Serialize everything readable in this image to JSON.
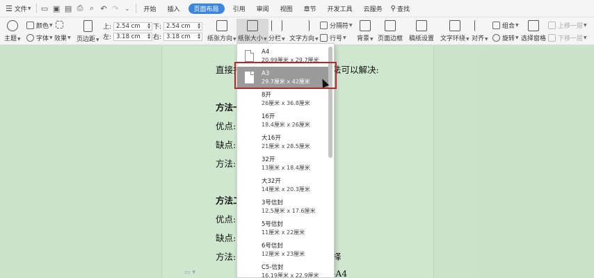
{
  "menubar": {
    "file_label": "文件",
    "tabs": [
      {
        "label": "开始"
      },
      {
        "label": "插入"
      },
      {
        "label": "页面布局"
      },
      {
        "label": "引用"
      },
      {
        "label": "审阅"
      },
      {
        "label": "视图"
      },
      {
        "label": "章节"
      },
      {
        "label": "开发工具"
      },
      {
        "label": "云服务"
      }
    ],
    "search_label": "查找"
  },
  "ribbon": {
    "theme_label": "主题",
    "color_label": "颜色",
    "font_label": "字体",
    "effect_label": "效果",
    "margin_label": "页边距",
    "top_label": "上:",
    "top_value": "2.54 cm",
    "bottom_label": "下:",
    "bottom_value": "2.54 cm",
    "left_label": "左:",
    "left_value": "3.18 cm",
    "right_label": "右:",
    "right_value": "3.18 cm",
    "orientation_label": "纸张方向",
    "paper_size_label": "纸张大小",
    "columns_label": "分栏",
    "text_direction_label": "文字方向",
    "separator_label": "分隔符",
    "line_number_label": "行号",
    "background_label": "背景",
    "page_border_label": "页面边框",
    "draft_setting_label": "稿纸设置",
    "text_wrap_label": "文字环绕",
    "align_label": "对齐",
    "group_label": "组合",
    "rotate_label": "旋转",
    "selection_pane_label": "选择窗格",
    "bring_forward_label": "上移一层",
    "send_backward_label": "下移一层"
  },
  "document": {
    "lines": [
      {
        "text": "直接打",
        "bold": false
      },
      {
        "text": "法可以解决:",
        "bold": false
      },
      {
        "text": "方法一",
        "bold": true
      },
      {
        "text": "优点:",
        "bold": false
      },
      {
        "text": "缺点:",
        "bold": false
      },
      {
        "text": "方法:",
        "bold": false
      },
      {
        "text": "方法二",
        "bold": true
      },
      {
        "text": "优点:",
        "bold": false
      },
      {
        "text": "缺点:",
        "bold": false
      },
      {
        "text": "方法:",
        "bold": false
      },
      {
        "text": "择",
        "bold": false
      },
      {
        "text": "-A4",
        "bold": false
      }
    ]
  },
  "paper_sizes": [
    {
      "name": "A4",
      "size": "20.99厘米 x 29.7厘米"
    },
    {
      "name": "A3",
      "size": "29.7厘米 x 42厘米"
    },
    {
      "name": "8开",
      "size": "26厘米 x 36.8厘米"
    },
    {
      "name": "16开",
      "size": "18.4厘米 x 26厘米"
    },
    {
      "name": "大16开",
      "size": "21厘米 x 28.5厘米"
    },
    {
      "name": "32开",
      "size": "13厘米 x 18.4厘米"
    },
    {
      "name": "大32开",
      "size": "14厘米 x 20.3厘米"
    },
    {
      "name": "3号信封",
      "size": "12.5厘米 x 17.6厘米"
    },
    {
      "name": "5号信封",
      "size": "11厘米 x 22厘米"
    },
    {
      "name": "6号信封",
      "size": "12厘米 x 23厘米"
    },
    {
      "name": "C5-信封",
      "size": "16.19厘米 x 22.9厘米"
    }
  ],
  "selected_paper": "A3",
  "colors": {
    "active_tab": "#3d86e0",
    "highlight": "#b3262b",
    "doc_bg": "#cfe6cf"
  }
}
